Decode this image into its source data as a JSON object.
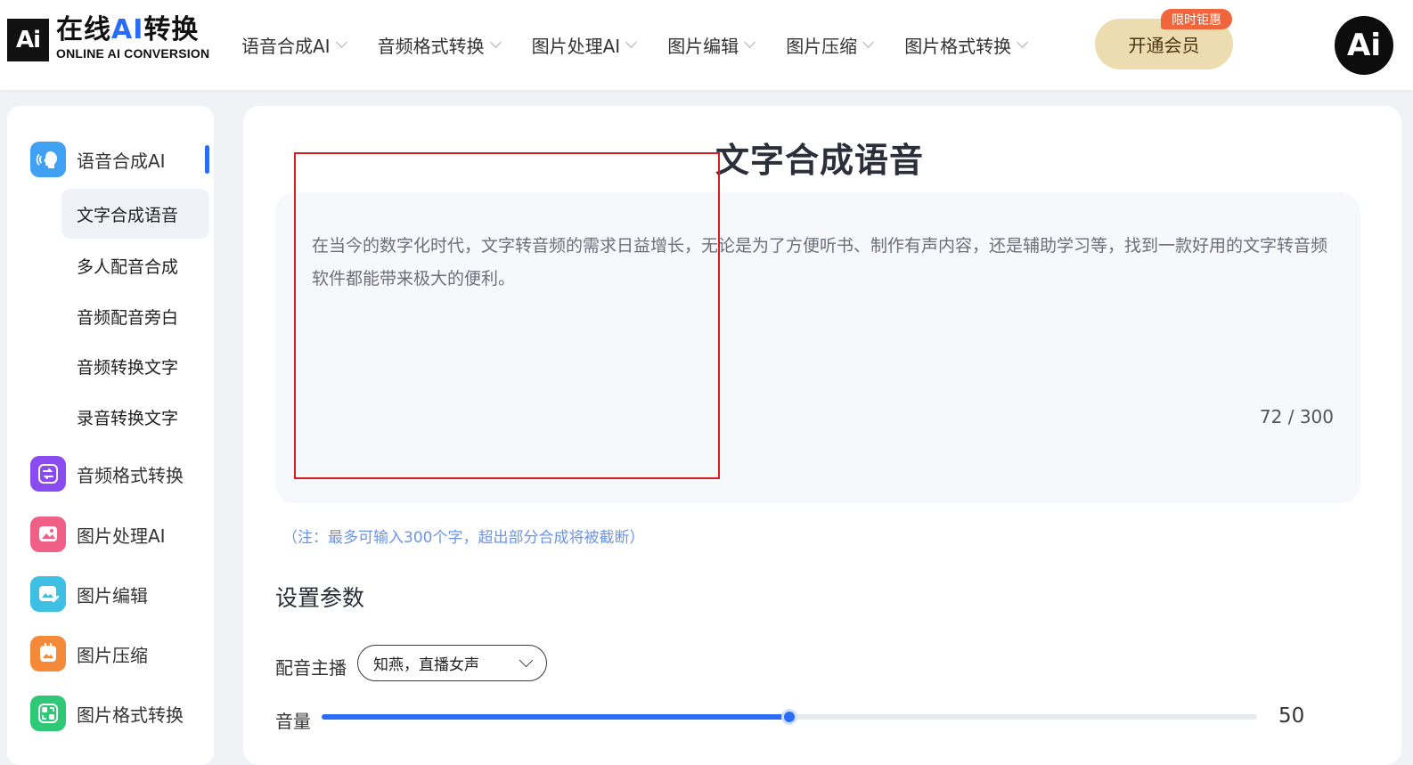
{
  "header": {
    "logo": {
      "badge": "Ai",
      "title_prefix": "在线",
      "title_ai": "AI",
      "title_suffix": "转换",
      "subtitle": "ONLINE AI CONVERSION"
    },
    "nav": [
      {
        "label": "语音合成AI"
      },
      {
        "label": "音频格式转换"
      },
      {
        "label": "图片处理AI"
      },
      {
        "label": "图片编辑"
      },
      {
        "label": "图片压缩"
      },
      {
        "label": "图片格式转换"
      }
    ],
    "vip_button": "开通会员",
    "promo_badge": "限时钜惠",
    "avatar": "Ai"
  },
  "sidebar": {
    "categories": [
      {
        "label": "语音合成AI",
        "icon": "speech-icon",
        "color": "#3fa0f4"
      },
      {
        "label": "音频格式转换",
        "icon": "audio-convert-icon",
        "color": "#8a4cf0"
      },
      {
        "label": "图片处理AI",
        "icon": "image-ai-icon",
        "color": "#f05f86"
      },
      {
        "label": "图片编辑",
        "icon": "image-edit-icon",
        "color": "#3ebfe4"
      },
      {
        "label": "图片压缩",
        "icon": "image-compress-icon",
        "color": "#f5893a"
      },
      {
        "label": "图片格式转换",
        "icon": "image-convert-icon",
        "color": "#2fc877"
      }
    ],
    "sub_items": [
      {
        "label": "文字合成语音"
      },
      {
        "label": "多人配音合成"
      },
      {
        "label": "音频配音旁白"
      },
      {
        "label": "音频转换文字"
      },
      {
        "label": "录音转换文字"
      }
    ]
  },
  "main": {
    "title": "文字合成语音",
    "text_content": "在当今的数字化时代，文字转音频的需求日益增长，无论是为了方便听书、制作有声内容，还是辅助学习等，找到一款好用的文字转音频软件都能带来极大的便利。",
    "char_count": "72 / 300",
    "note": "（注：最多可输入300个字，超出部分合成将被截断）",
    "settings_title": "设置参数",
    "voice_label": "配音主播",
    "voice_value": "知燕，直播女声",
    "volume_label": "音量",
    "volume_value": "50",
    "volume_fraction": 0.5
  }
}
